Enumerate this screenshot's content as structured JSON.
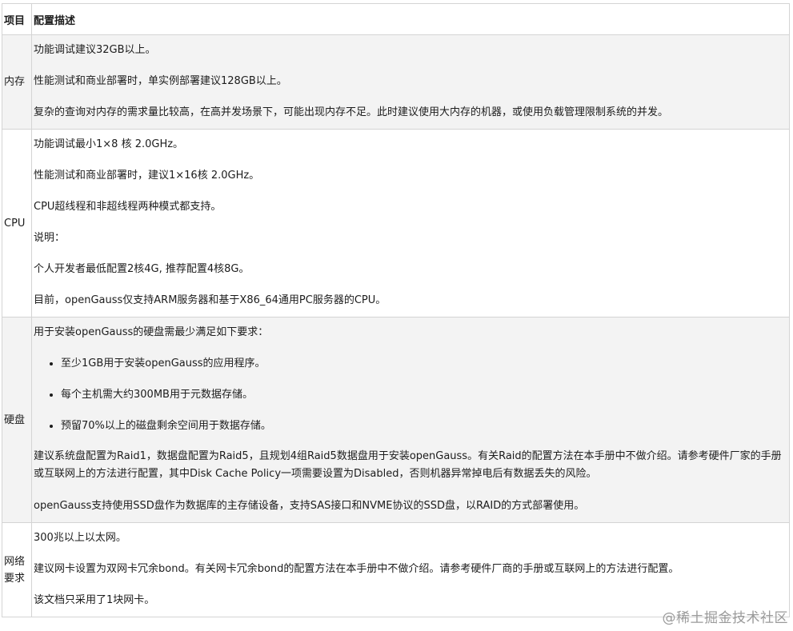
{
  "table": {
    "headers": [
      "项目",
      "配置描述"
    ],
    "rows": [
      {
        "item": "内存",
        "paragraphs": [
          "功能调试建议32GB以上。",
          "性能测试和商业部署时，单实例部署建议128GB以上。",
          "复杂的查询对内存的需求量比较高，在高并发场景下，可能出现内存不足。此时建议使用大内存的机器，或使用负载管理限制系统的并发。"
        ]
      },
      {
        "item": "CPU",
        "paragraphs": [
          "功能调试最小1×8 核 2.0GHz。",
          "性能测试和商业部署时，建议1×16核 2.0GHz。",
          "CPU超线程和非超线程两种模式都支持。",
          "说明：",
          "个人开发者最低配置2核4G, 推荐配置4核8G。",
          "目前，openGauss仅支持ARM服务器和基于X86_64通用PC服务器的CPU。"
        ]
      },
      {
        "item": "硬盘",
        "intro": "用于安装openGauss的硬盘需最少满足如下要求：",
        "bullets": [
          "至少1GB用于安装openGauss的应用程序。",
          "每个主机需大约300MB用于元数据存储。",
          "预留70%以上的磁盘剩余空间用于数据存储。"
        ],
        "paragraphs": [
          "建议系统盘配置为Raid1，数据盘配置为Raid5，且规划4组Raid5数据盘用于安装openGauss。有关Raid的配置方法在本手册中不做介绍。请参考硬件厂家的手册或互联网上的方法进行配置，其中Disk Cache Policy一项需要设置为Disabled，否则机器异常掉电后有数据丢失的风险。",
          "openGauss支持使用SSD盘作为数据库的主存储设备，支持SAS接口和NVME协议的SSD盘，以RAID的方式部署使用。"
        ]
      },
      {
        "item": "网络要求",
        "paragraphs": [
          "300兆以上以太网。",
          "建议网卡设置为双网卡冗余bond。有关网卡冗余bond的配置方法在本手册中不做介绍。请参考硬件厂商的手册或互联网上的方法进行配置。",
          "该文档只采用了1块网卡。"
        ]
      }
    ]
  },
  "watermark": "@稀土掘金技术社区"
}
